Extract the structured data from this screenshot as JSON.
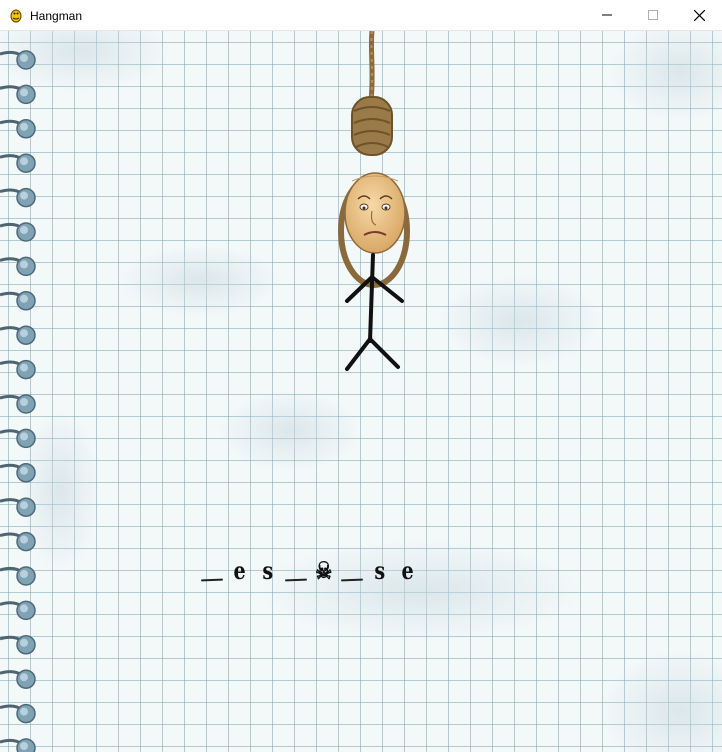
{
  "window": {
    "title": "Hangman",
    "app_icon": "pygame-snake-icon",
    "controls": [
      "minimize-icon",
      "maximize-icon",
      "close-icon"
    ]
  },
  "game": {
    "hangman_parts_shown": [
      "rope",
      "head",
      "body",
      "left-arm",
      "right-arm",
      "left-leg",
      "right-leg"
    ],
    "head_style": "meme-face",
    "word_slots": [
      "_",
      "e",
      "s",
      "_",
      "☠",
      "_",
      "s",
      "e"
    ]
  },
  "colors": {
    "grid_line": "#78a5b4",
    "paper": "#f3f8f9",
    "rope": "#8a6a3c",
    "ink": "#111111"
  }
}
